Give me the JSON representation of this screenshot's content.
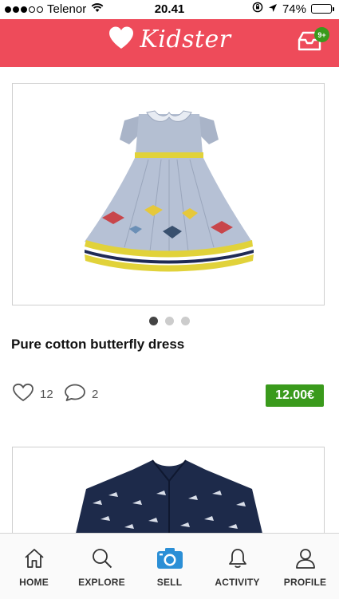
{
  "status_bar": {
    "carrier": "Telenor",
    "time": "20.41",
    "battery": "74%",
    "battery_level": 0.74,
    "signal_bars_filled": 3,
    "signal_bars_total": 5
  },
  "header": {
    "logo_text": "Kidster",
    "inbox_badge": "9+",
    "background_color": "#ee4b5a"
  },
  "products": [
    {
      "title": "Pure cotton butterfly dress",
      "likes": "12",
      "comments": "2",
      "price": "12.00€",
      "image_icon": "blue-dress-with-butterflies",
      "carousel_total": 3,
      "carousel_active": 1
    },
    {
      "image_icon": "navy-shirt-print"
    }
  ],
  "tabs": [
    {
      "label": "HOME",
      "icon": "home-icon"
    },
    {
      "label": "EXPLORE",
      "icon": "search-icon"
    },
    {
      "label": "SELL",
      "icon": "camera-icon"
    },
    {
      "label": "ACTIVITY",
      "icon": "bell-icon"
    },
    {
      "label": "PROFILE",
      "icon": "user-icon"
    }
  ],
  "colors": {
    "accent": "#ee4b5a",
    "price_bg": "#3a9a1c",
    "sell_blue": "#2b8fd6"
  }
}
